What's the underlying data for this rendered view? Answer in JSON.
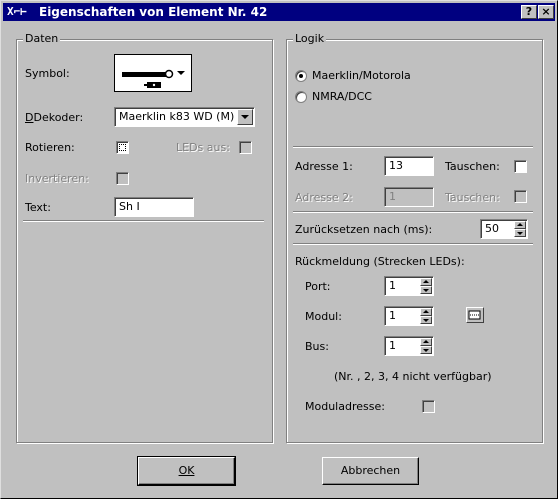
{
  "window": {
    "title": "Eigenschaften von Element Nr. 42",
    "help_glyph": "?",
    "close_glyph": "×"
  },
  "daten": {
    "legend": "Daten",
    "symbol_label": "Symbol:",
    "dekoder_label": "Dekoder:",
    "dekoder_value": "Maerklin k83 WD (M)",
    "rotieren_label": "Rotieren:",
    "rotieren_checked": false,
    "leds_aus_label": "LEDs aus:",
    "invertieren_label": "Invertieren:",
    "text_label": "Text:",
    "text_value": "Sh I"
  },
  "logik": {
    "legend": "Logik",
    "protocol_options": [
      "Maerklin/Motorola",
      "NMRA/DCC"
    ],
    "protocol_selected": "Maerklin/Motorola",
    "adresse1_label": "Adresse 1:",
    "adresse1_value": "13",
    "tauschen1_label": "Tauschen:",
    "adresse2_label": "Adresse 2:",
    "adresse2_value": "1",
    "tauschen2_label": "Tauschen:",
    "reset_label": "Zurücksetzen nach (ms):",
    "reset_value": "50",
    "rueckmeldung_label": "Rückmeldung (Strecken LEDs):",
    "port_label": "Port:",
    "port_value": "1",
    "modul_label": "Modul:",
    "modul_value": "1",
    "bus_label": "Bus:",
    "bus_value": "1",
    "note": "(Nr. , 2, 3, 4 nicht verfügbar)",
    "moduladresse_label": "Moduladresse:"
  },
  "buttons": {
    "ok": "OK",
    "cancel": "Abbrechen"
  }
}
